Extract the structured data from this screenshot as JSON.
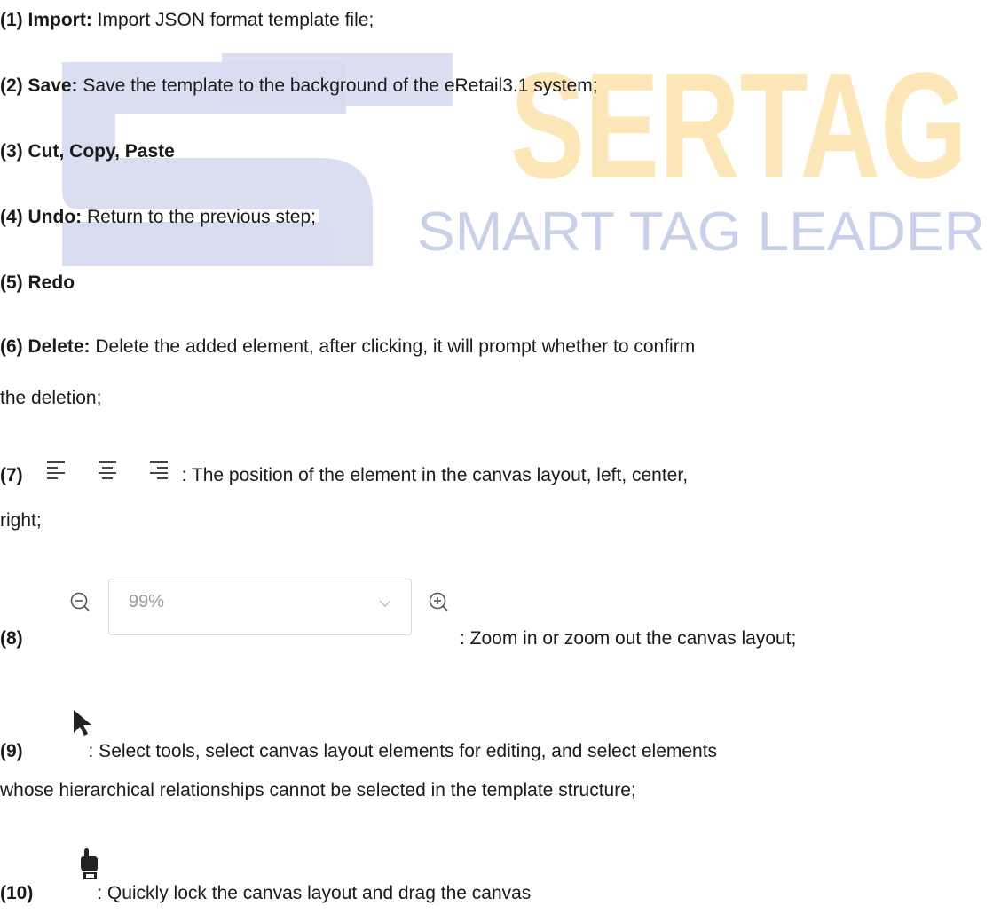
{
  "watermark": {
    "brand": "SERTAG",
    "tagline": "SMART TAG LEADER",
    "colors": {
      "logo": "#d8dcf0",
      "brand": "#fde6b8",
      "tagline": "#c9d0ea"
    }
  },
  "items": [
    {
      "num": "(1)",
      "label": "Import:",
      "text": " Import JSON format template file;"
    },
    {
      "num": "(2)",
      "label": "Save:",
      "text": " Save the template to the background of the eRetail3.1 system;"
    },
    {
      "num": "(3)",
      "label": "Cut, Copy, Paste",
      "text": ""
    },
    {
      "num": "(4)",
      "label": "Undo:",
      "text": " Return to the previous step;"
    },
    {
      "num": "(5)",
      "label": "Redo",
      "text": ""
    },
    {
      "num": "(6)",
      "label": "Delete:",
      "text": " Delete the added element, after clicking, it will prompt whether to confirm",
      "text2": "the deletion;"
    },
    {
      "num": "(7)",
      "text": ": The position of the element in the canvas layout, left, center,",
      "text2": "right;",
      "icons": [
        "align-left-icon",
        "align-center-icon",
        "align-right-icon"
      ]
    },
    {
      "num": "(8)",
      "zoom_value": "99%",
      "text": ": Zoom in or zoom out the canvas layout;",
      "icons": [
        "zoom-out-icon",
        "chevron-down-icon",
        "zoom-in-icon"
      ]
    },
    {
      "num": "(9)",
      "text": ": Select tools, select canvas layout elements for editing, and select elements",
      "text2": "whose hierarchical relationships cannot be selected in the template structure;",
      "icons": [
        "select-arrow-icon"
      ]
    },
    {
      "num": "(10)",
      "text": ": Quickly lock the canvas layout and drag the canvas",
      "icons": [
        "hand-pan-icon"
      ]
    }
  ]
}
